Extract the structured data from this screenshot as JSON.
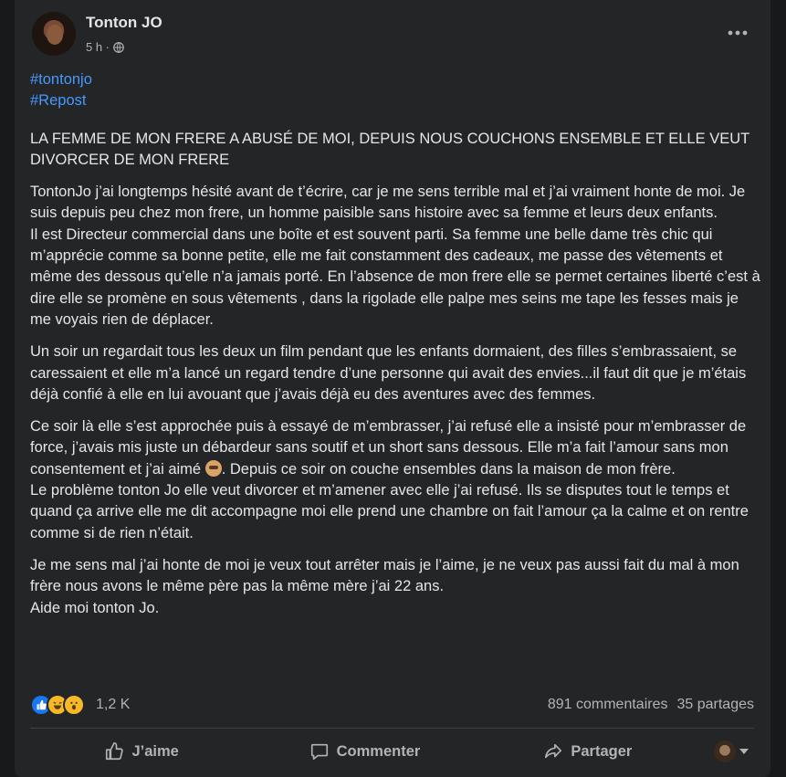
{
  "post": {
    "author": "Tonton JO",
    "time": "5 h ·",
    "hashtags": [
      "#tontonjo",
      "#Repost"
    ],
    "title": "LA FEMME DE MON FRERE A ABUSÉ DE MOI, DEPUIS NOUS COUCHONS ENSEMBLE ET ELLE VEUT DIVORCER DE MON FRERE",
    "p1": "TontonJo j’ai longtemps hésité avant  de t’écrire, car je me sens terrible mal et j’ai vraiment honte de moi. Je suis depuis peu chez mon frere, un homme paisible sans histoire avec sa femme et leurs deux enfants.",
    "p2": "Il est Directeur commercial dans une boîte et est souvent parti. Sa femme une belle dame très chic qui m’apprécie comme sa bonne petite, elle me fait constamment des cadeaux, me passe des vêtements et même des dessous qu’elle n’a jamais porté. En l’absence de mon frere elle se permet certaines liberté c’est à dire elle se promène en sous vêtements , dans la rigolade elle palpe mes seins me tape les fesses mais je me voyais rien de déplacer.",
    "p3": "Un soir un regardait tous les deux un film pendant que les enfants dormaient, des filles s’embrassaient, se caressaient et elle m’a lancé un regard tendre d’une personne qui avait des envies...il faut dit que je m’étais déjà confié à elle en lui avouant que j’avais déjà eu des aventures avec des femmes.",
    "p4a": "Ce soir là elle s’est approchée puis à essayé de m’embrasser, j’ai refusé elle a insisté pour m’embrasser de force, j’avais mis juste un débardeur sans soutif et un short sans dessous. Elle m’a fait l’amour sans mon consentement et j’ai aimé ",
    "p4b": ". Depuis ce soir on couche ensembles dans la maison de mon frère.",
    "p5": "Le problème tonton Jo elle veut divorcer et m’amener avec elle j’ai refusé. Ils se disputes tout le temps et quand ça arrive elle me dit accompagne moi elle prend une chambre on fait l’amour ça la calme et on rentre comme si de rien n’était.",
    "p6": "Je me sens mal j’ai honte de moi je veux tout arrêter mais je l’aime, je ne veux pas aussi fait du mal à mon frère nous avons le même père pas la même mère j’ai 22 ans.",
    "p7": "Aide moi tonton Jo."
  },
  "stats": {
    "reaction_icons": [
      "like-icon",
      "haha-icon",
      "wow-icon"
    ],
    "reactions_count": "1,2 K",
    "comments": "891 commentaires",
    "shares": "35 partages"
  },
  "actions": {
    "like": "J’aime",
    "comment": "Commenter",
    "share": "Partager"
  },
  "colors": {
    "background": "#18191a",
    "card": "#242526",
    "text": "#e4e6eb",
    "secondary": "#b0b3b8",
    "link": "#4599ff",
    "like_blue": "#1877f2"
  }
}
